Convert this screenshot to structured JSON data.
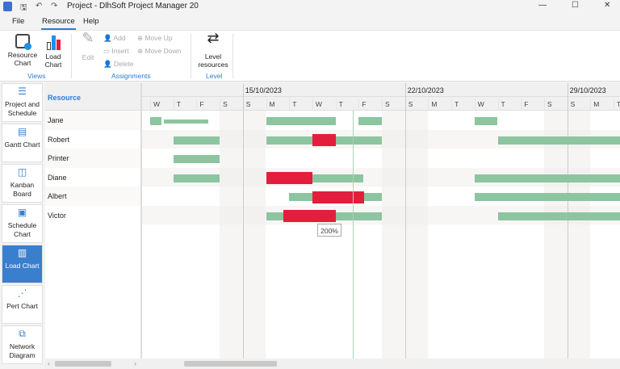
{
  "window": {
    "title": "Project - DlhSoft Project Manager 20",
    "minimize": "—",
    "maximize": "☐",
    "close": "✕"
  },
  "quick_access": {
    "app_icon": "app-icon",
    "save": "🖫",
    "undo": "↶",
    "redo": "↷"
  },
  "menu": [
    {
      "label": "File"
    },
    {
      "label": "Resource",
      "active": true
    },
    {
      "label": "Help"
    }
  ],
  "ribbon": {
    "views": {
      "label": "Views",
      "resource_chart": "Resource\nChart",
      "load_chart": "Load\nChart"
    },
    "assignments": {
      "label": "Assignments",
      "edit": "Edit",
      "add": "Add",
      "insert": "Insert",
      "delete": "Delete",
      "move_up": "Move Up",
      "move_down": "Move Down"
    },
    "level": {
      "label": "Level",
      "level_resources": "Level\nresources"
    }
  },
  "sidebar": [
    {
      "label": "Project and Schedule",
      "icon": "list-icon"
    },
    {
      "label": "Gantt Chart",
      "icon": "gantt-icon"
    },
    {
      "label": "Kanban Board",
      "icon": "kanban-icon"
    },
    {
      "label": "Schedule Chart",
      "icon": "schedule-icon"
    },
    {
      "label": "Load Chart",
      "icon": "load-chart-icon",
      "active": true
    },
    {
      "label": "Pert Chart",
      "icon": "pert-icon"
    },
    {
      "label": "Network Diagram",
      "icon": "network-icon"
    }
  ],
  "grid": {
    "header": "Resource",
    "rows": [
      "Jane",
      "Robert",
      "Printer",
      "Diane",
      "Albert",
      "Victor"
    ]
  },
  "timeline": {
    "weeks": [
      "15/10/2023",
      "22/10/2023",
      "29/10/2023"
    ],
    "days": [
      "W",
      "T",
      "F",
      "S",
      "S",
      "M",
      "T",
      "W",
      "T",
      "F",
      "S",
      "S",
      "M",
      "T",
      "W",
      "T",
      "F",
      "S",
      "S",
      "M",
      "T"
    ],
    "colors": {
      "normal": "#8cc59f",
      "over": "#e31e3c"
    },
    "bars": [
      [
        {
          "s": 0,
          "e": 0.5
        },
        {
          "s": 0.6,
          "e": 2.5,
          "thin": true
        },
        {
          "s": 5,
          "e": 8
        },
        {
          "s": 9,
          "e": 10
        },
        {
          "s": 14,
          "e": 15
        }
      ],
      [
        {
          "s": 1,
          "e": 3
        },
        {
          "s": 5,
          "e": 10
        },
        {
          "s": 7,
          "e": 8,
          "over": true
        },
        {
          "s": 15,
          "e": 21
        }
      ],
      [
        {
          "s": 1,
          "e": 3
        }
      ],
      [
        {
          "s": 1,
          "e": 3
        },
        {
          "s": 5,
          "e": 7,
          "over": true
        },
        {
          "s": 7,
          "e": 9.2
        },
        {
          "s": 14,
          "e": 21
        }
      ],
      [
        {
          "s": 6,
          "e": 10
        },
        {
          "s": 7,
          "e": 9.25,
          "over": true
        },
        {
          "s": 14,
          "e": 20.9
        }
      ],
      [
        {
          "s": 5,
          "e": 10
        },
        {
          "s": 5.75,
          "e": 8,
          "over": true
        },
        {
          "s": 15,
          "e": 21
        }
      ]
    ],
    "tooltip": "200%"
  }
}
